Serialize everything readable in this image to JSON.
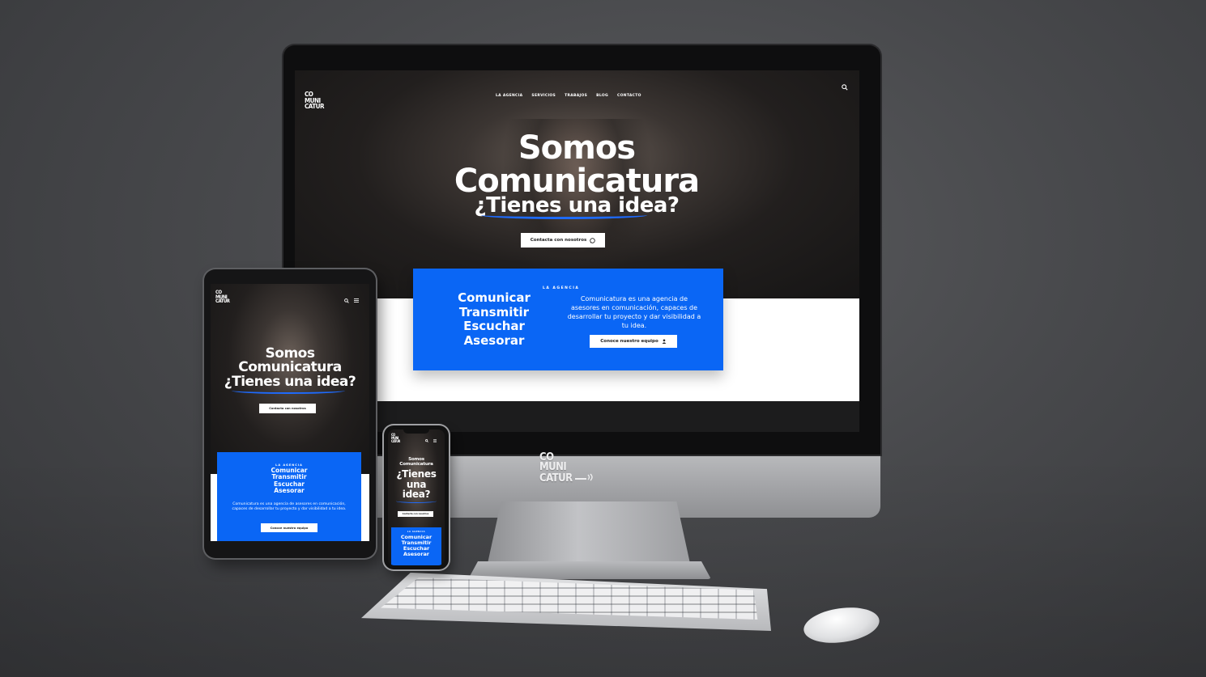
{
  "site": {
    "logo": [
      "CO",
      "MUNI",
      "CATUR"
    ],
    "nav": [
      "LA AGENCIA",
      "SERVICIOS",
      "TRABAJOS",
      "BLOG",
      "CONTACTO"
    ],
    "hero": {
      "line1": "Somos",
      "line2": "Comunicatura",
      "line3": "¿Tienes una idea?",
      "phone_lines": [
        "Somos",
        "Comunicatura",
        "¿Tienes",
        "una",
        "idea?"
      ]
    },
    "contact_button": "Contacta con nosotros",
    "section_label": "LA AGENCIA",
    "verbs": [
      "Comunicar",
      "Transmitir",
      "Escuchar",
      "Asesorar"
    ],
    "about_text": "Comunicatura es una agencia de asesores en comunicación, capaces de desarrollar tu proyecto y dar visibilidad a tu idea.",
    "team_button": "Conoce nuestro equipo"
  },
  "chin_logo": [
    "CO",
    "MUNI",
    "CATUR"
  ],
  "colors": {
    "accent_blue": "#0a66f5",
    "underline_blue": "#1e6bff",
    "background": "#48494c"
  },
  "icons": {
    "search": "search-icon",
    "menu": "hamburger-menu-icon",
    "whatsapp": "whatsapp-icon",
    "team": "person-icon",
    "sound": "sound-waves-icon"
  }
}
